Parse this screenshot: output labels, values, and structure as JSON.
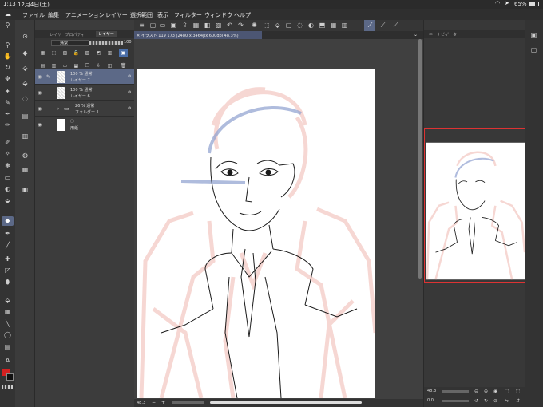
{
  "status": {
    "time": "1:13",
    "date": "12月4日(土)",
    "battery": "65%"
  },
  "menu": {
    "items": [
      "ファイル",
      "編集",
      "アニメーション",
      "レイヤー",
      "選択範囲",
      "表示",
      "フィルター",
      "ウィンドウ",
      "ヘルプ"
    ]
  },
  "layer_panel": {
    "tabs": [
      "レイヤープロパティ",
      "レイヤー"
    ],
    "blend_mode": "通常",
    "opacity": "100",
    "layers": [
      {
        "opacity": "100 % 通常",
        "name": "レイヤー 7",
        "selected": true
      },
      {
        "opacity": "100 % 通常",
        "name": "レイヤー 6",
        "selected": false
      },
      {
        "opacity": "26 % 通常",
        "name": "フォルダー 1",
        "selected": false
      },
      {
        "opacity": "",
        "name": "用紙",
        "selected": false
      }
    ]
  },
  "document": {
    "tab_title": "イラスト 119 173 (2480 x 3464px 600dpi 48.3%)"
  },
  "navigator": {
    "tab_title": "ナビゲーター",
    "zoom": "48.3",
    "rotation": "0.0"
  },
  "canvas": {
    "zoom": "48.3"
  },
  "colors": {
    "main": "#d42020",
    "sub": "#111111",
    "accent": "#5c6987"
  }
}
